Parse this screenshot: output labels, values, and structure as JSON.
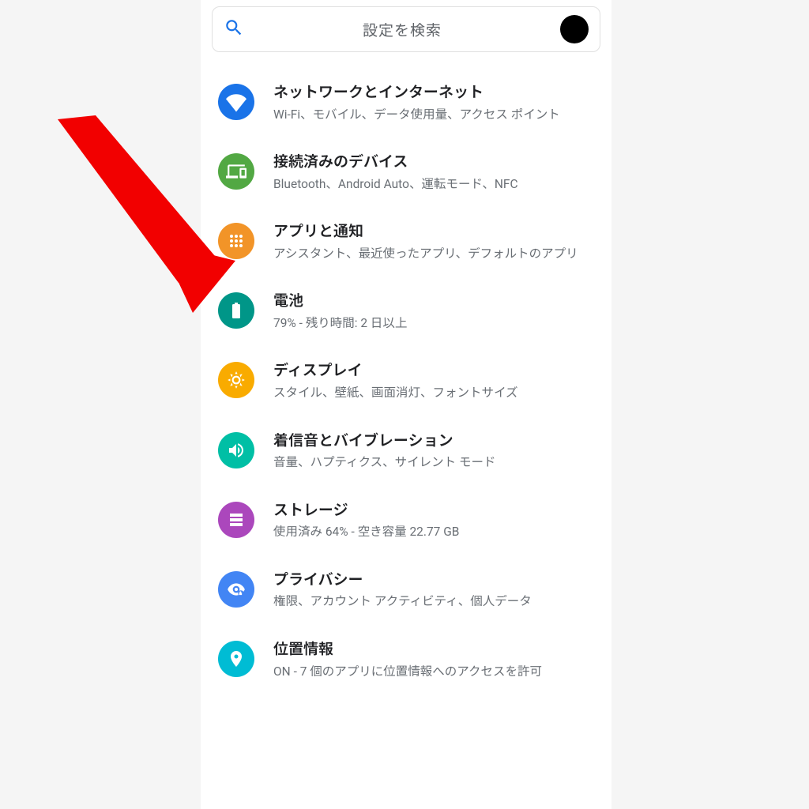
{
  "search": {
    "placeholder": "設定を検索"
  },
  "colors": {
    "network": "#1a73e8",
    "connected": "#52a843",
    "apps": "#f29428",
    "battery": "#009688",
    "display": "#f9ab00",
    "sound": "#00bfa5",
    "storage": "#ab47bc",
    "privacy": "#4285f4",
    "location": "#00bcd4",
    "arrow": "#f20000"
  },
  "items": [
    {
      "key": "network",
      "icon": "wifi-icon",
      "title": "ネットワークとインターネット",
      "subtitle": "Wi-Fi、モバイル、データ使用量、アクセス ポイント"
    },
    {
      "key": "connected",
      "icon": "devices-icon",
      "title": "接続済みのデバイス",
      "subtitle": "Bluetooth、Android Auto、運転モード、NFC"
    },
    {
      "key": "apps",
      "icon": "apps-icon",
      "title": "アプリと通知",
      "subtitle": "アシスタント、最近使ったアプリ、デフォルトのアプリ"
    },
    {
      "key": "battery",
      "icon": "battery-icon",
      "title": "電池",
      "subtitle": "79% - 残り時間: 2 日以上"
    },
    {
      "key": "display",
      "icon": "display-icon",
      "title": "ディスプレイ",
      "subtitle": "スタイル、壁紙、画面消灯、フォントサイズ"
    },
    {
      "key": "sound",
      "icon": "sound-icon",
      "title": "着信音とバイブレーション",
      "subtitle": "音量、ハプティクス、サイレント モード"
    },
    {
      "key": "storage",
      "icon": "storage-icon",
      "title": "ストレージ",
      "subtitle": "使用済み 64% - 空き容量 22.77 GB"
    },
    {
      "key": "privacy",
      "icon": "privacy-icon",
      "title": "プライバシー",
      "subtitle": "権限、アカウント アクティビティ、個人データ"
    },
    {
      "key": "location",
      "icon": "location-icon",
      "title": "位置情報",
      "subtitle": "ON - 7 個のアプリに位置情報へのアクセスを許可"
    }
  ],
  "annotation": {
    "target_key": "apps"
  }
}
